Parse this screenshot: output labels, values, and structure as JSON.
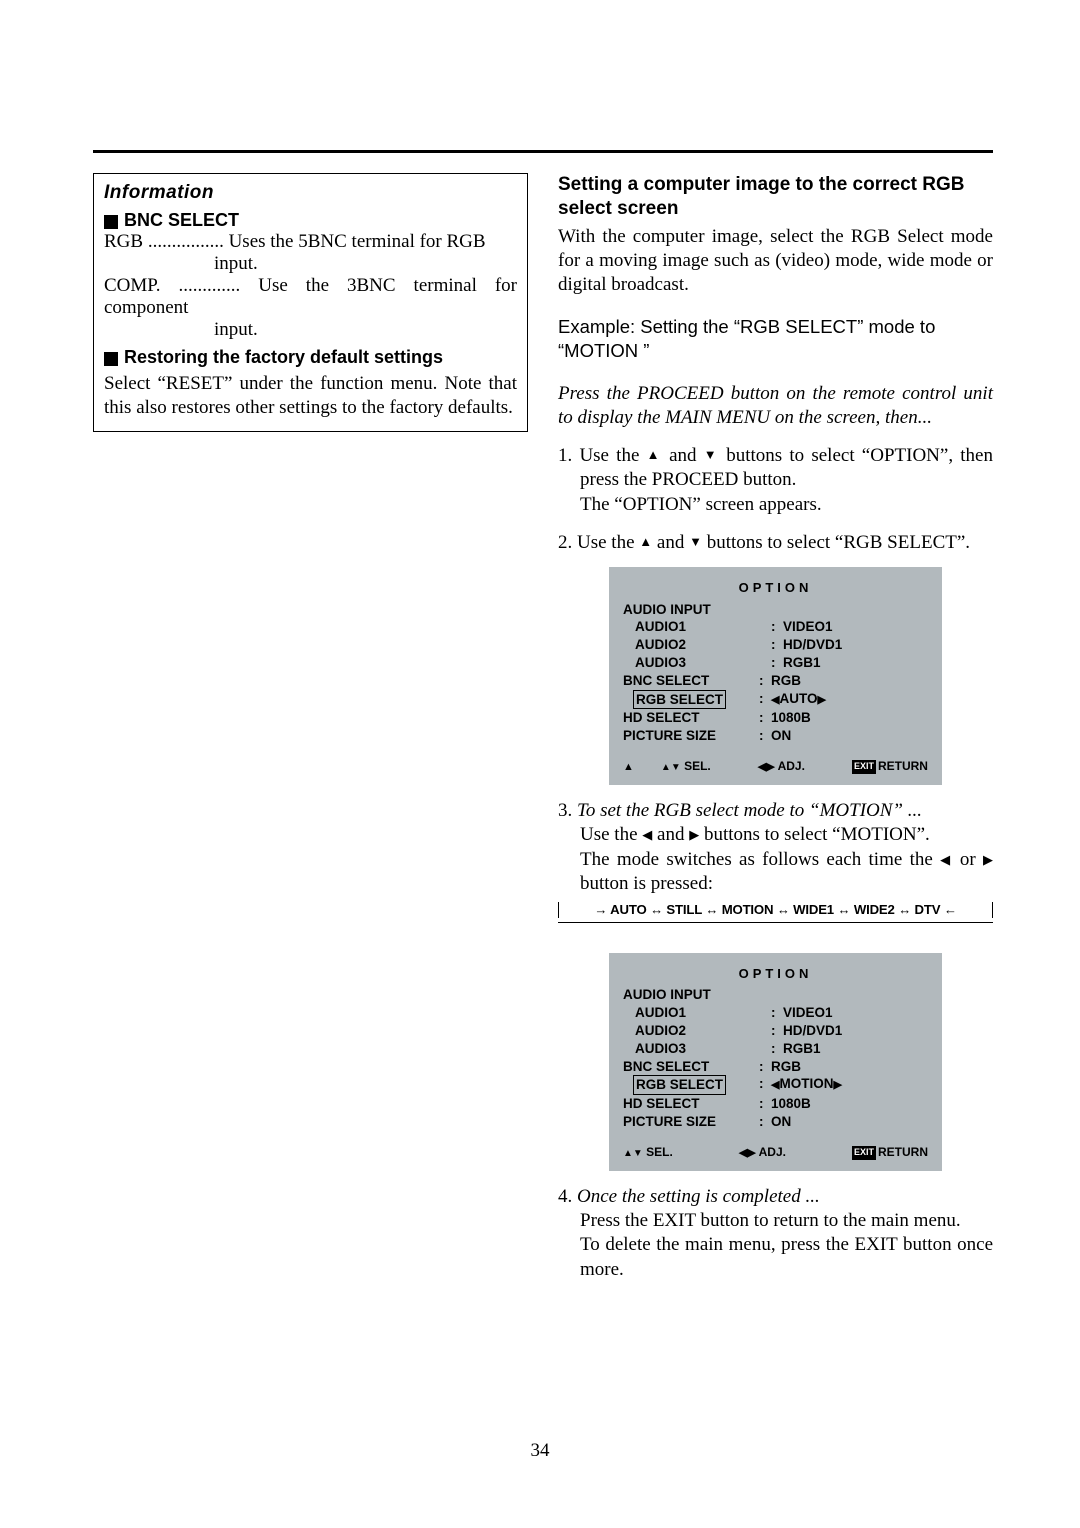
{
  "page_number": "34",
  "info": {
    "header": "Information",
    "bnc_title": "BNC SELECT",
    "rgb_label": "RGB",
    "rgb_desc1": "Uses the 5BNC terminal for RGB",
    "rgb_desc2": "input.",
    "comp_label": "COMP.",
    "comp_desc1": "Use the 3BNC terminal for component",
    "comp_desc2": "input.",
    "restore_title": "Restoring the factory default settings",
    "restore_body": "Select “RESET” under the function menu. Note that this also restores other settings to the factory defaults."
  },
  "right": {
    "h1": "Setting a computer image to the correct RGB select screen",
    "intro": "With the computer image, select the RGB Select mode for a moving image such as (video) mode, wide mode or digital broadcast.",
    "example": "Example: Setting the “RGB SELECT” mode to “MOTION ”",
    "press": "Press the PROCEED button on the remote control unit to display the MAIN MENU on the screen, then...",
    "step1a": "1. Use the ",
    "step1b": " and ",
    "step1c": " buttons to select “OPTION”, then press the PROCEED button.",
    "step1d": "The “OPTION” screen appears.",
    "step2a": "2. Use the ",
    "step2b": " and ",
    "step2c": " buttons to select “RGB SELECT”.",
    "step3a": "3.",
    "step3b": "To set the RGB select mode to “MOTION” ...",
    "step3c": "Use the ",
    "step3d": " and ",
    "step3e": " buttons to select “MOTION”.",
    "step3f": "The mode switches as follows each time the ",
    "step3g": " or ",
    "step3h": " button is pressed:",
    "modeseq": "→ AUTO ↔ STILL ↔ MOTION ↔ WIDE1 ↔ WIDE2 ↔ DTV ←",
    "step4a": "4.",
    "step4b": "Once the setting is completed ...",
    "step4c": "Press the EXIT button to return to the main menu.",
    "step4d": "To delete the main menu, press the EXIT button once more."
  },
  "osd": {
    "title": "OPTION",
    "audio_input": "AUDIO INPUT",
    "rows": [
      {
        "l": "AUDIO1",
        "r": "VIDEO1"
      },
      {
        "l": "AUDIO2",
        "r": "HD/DVD1"
      },
      {
        "l": "AUDIO3",
        "r": "RGB1"
      },
      {
        "l": "BNC SELECT",
        "r": "RGB",
        "top": true
      }
    ],
    "rgb_select_label": "RGB SELECT",
    "rgb_value_auto": "AUTO",
    "rgb_value_motion": "MOTION",
    "tail": [
      {
        "l": "HD SELECT",
        "r": "1080B",
        "top": true
      },
      {
        "l": "PICTURE SIZE",
        "r": "ON",
        "top": true
      }
    ],
    "footer_sel": "SEL.",
    "footer_adj": "ADJ.",
    "footer_exit": "EXIT",
    "footer_return": "RETURN"
  }
}
